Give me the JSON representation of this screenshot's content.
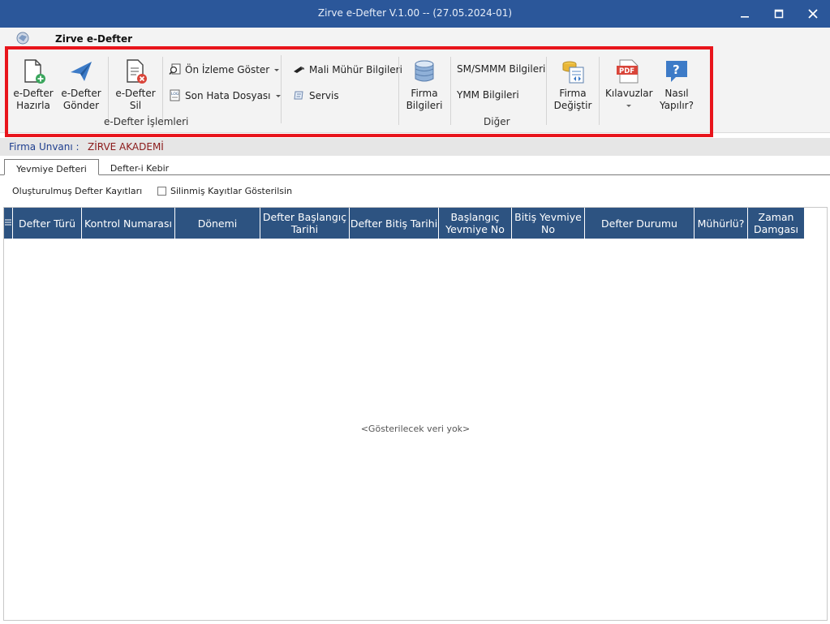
{
  "window": {
    "title": "Zirve e-Defter V.1.00  -- (27.05.2024-01)"
  },
  "app": {
    "name": "Zirve e-Defter"
  },
  "ribbon": {
    "hazirla": "e-Defter\nHazırla",
    "hazirla_l1": "e-Defter",
    "hazirla_l2": "Hazırla",
    "gonder_l1": "e-Defter",
    "gonder_l2": "Gönder",
    "sil_l1": "e-Defter",
    "sil_l2": "Sil",
    "on_izleme": "Ön İzleme Göster",
    "son_hata": "Son Hata Dosyası",
    "group_edefter": "e-Defter İşlemleri",
    "mali_muhur": "Mali Mühür Bilgileri",
    "servis": "Servis",
    "firma_bilgi_l1": "Firma",
    "firma_bilgi_l2": "Bilgileri",
    "sm_smmm": "SM/SMMM Bilgileri",
    "ymm": "YMM Bilgileri",
    "firma_degistir_l1": "Firma",
    "firma_degistir_l2": "Değiştir",
    "kilavuzlar": "Kılavuzlar",
    "nasil_l1": "Nasıl",
    "nasil_l2": "Yapılır?",
    "group_diger": "Diğer"
  },
  "firma": {
    "label": "Firma Unvanı :",
    "value": "ZİRVE AKADEMİ"
  },
  "tabs": [
    {
      "label": "Yevmiye Defteri"
    },
    {
      "label": "Defter-i Kebir"
    }
  ],
  "filters": {
    "created_label": "Oluşturulmuş Defter Kayıtları",
    "show_deleted": "Silinmiş Kayıtlar Gösterilsin"
  },
  "grid": {
    "columns": [
      {
        "l1": "Defter Türü",
        "l2": ""
      },
      {
        "l1": "Kontrol Numarası",
        "l2": ""
      },
      {
        "l1": "Dönemi",
        "l2": ""
      },
      {
        "l1": "Defter Başlangıç",
        "l2": "Tarihi"
      },
      {
        "l1": "Defter Bitiş Tarihi",
        "l2": ""
      },
      {
        "l1": "Başlangıç",
        "l2": "Yevmiye No"
      },
      {
        "l1": "Bitiş Yevmiye",
        "l2": "No"
      },
      {
        "l1": "Defter Durumu",
        "l2": ""
      },
      {
        "l1": "Mühürlü?",
        "l2": ""
      },
      {
        "l1": "Zaman",
        "l2": "Damgası"
      }
    ],
    "empty_text": "<Gösterilecek veri yok>"
  },
  "colors": {
    "titlebar": "#2b579a",
    "grid_header": "#2d5381",
    "highlight": "#e8141b",
    "firma_label": "#1f3f8f",
    "firma_value": "#8b1a1a"
  }
}
